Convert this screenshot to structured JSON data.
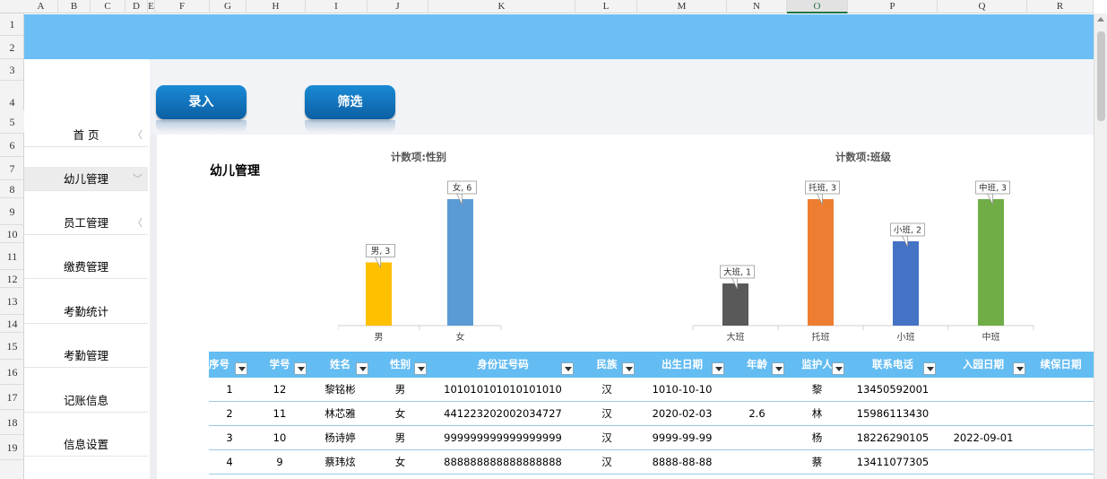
{
  "columns": [
    "A",
    "B",
    "C",
    "D",
    "E",
    "F",
    "G",
    "H",
    "I",
    "J",
    "K",
    "L",
    "M",
    "N",
    "O",
    "P",
    "Q",
    "R"
  ],
  "rows": [
    "1",
    "2",
    "3",
    "4",
    "5",
    "6",
    "7",
    "8",
    "9",
    "10",
    "11",
    "12",
    "13",
    "14",
    "15",
    "16",
    "17",
    "18",
    "19"
  ],
  "toolbar": {
    "entry_label": "录入",
    "filter_label": "筛选"
  },
  "sidebar": {
    "items": [
      {
        "label": "首 页",
        "chevron": "〈"
      },
      {
        "label": "幼儿管理",
        "chevron": "﹀"
      },
      {
        "label": "员工管理",
        "chevron": "〈"
      },
      {
        "label": "缴费管理",
        "chevron": ""
      },
      {
        "label": "考勤统计",
        "chevron": ""
      },
      {
        "label": "考勤管理",
        "chevron": ""
      },
      {
        "label": "记账信息",
        "chevron": ""
      },
      {
        "label": "信息设置",
        "chevron": ""
      }
    ]
  },
  "page": {
    "title": "幼儿管理"
  },
  "chart_data": [
    {
      "type": "bar",
      "title": "计数项:性别",
      "categories": [
        "男",
        "女"
      ],
      "values": [
        3,
        6
      ],
      "data_labels": [
        "男, 3",
        "女, 6"
      ],
      "colors": [
        "#ffc000",
        "#5b9bd5"
      ],
      "ylim": [
        0,
        6
      ]
    },
    {
      "type": "bar",
      "title": "计数项:班级",
      "categories": [
        "大班",
        "托班",
        "小班",
        "中班"
      ],
      "values": [
        1,
        3,
        2,
        3
      ],
      "data_labels": [
        "大班, 1",
        "托班, 3",
        "小班, 2",
        "中班, 3"
      ],
      "colors": [
        "#595959",
        "#ed7d31",
        "#4472c4",
        "#70ad47"
      ],
      "ylim": [
        0,
        3
      ]
    }
  ],
  "table": {
    "headers": [
      "序号",
      "学号",
      "姓名",
      "性别",
      "身份证号码",
      "民族",
      "出生日期",
      "年龄",
      "监护人",
      "联系电话",
      "入园日期",
      "续保日期"
    ],
    "rows": [
      [
        "1",
        "12",
        "黎铭彬",
        "男",
        "101010101010101010",
        "汉",
        "1010-10-10",
        "",
        "黎",
        "13450592001",
        "",
        ""
      ],
      [
        "2",
        "11",
        "林芯雅",
        "女",
        "441223202002034727",
        "汉",
        "2020-02-03",
        "2.6",
        "林",
        "15986113430",
        "",
        ""
      ],
      [
        "3",
        "10",
        "杨诗婷",
        "男",
        "999999999999999999",
        "汉",
        "9999-99-99",
        "",
        "杨",
        "18226290105",
        "2022-09-01",
        ""
      ],
      [
        "4",
        "9",
        "蔡玮炫",
        "女",
        "888888888888888888",
        "汉",
        "8888-88-88",
        "",
        "蔡",
        "13411077305",
        "",
        ""
      ]
    ]
  }
}
